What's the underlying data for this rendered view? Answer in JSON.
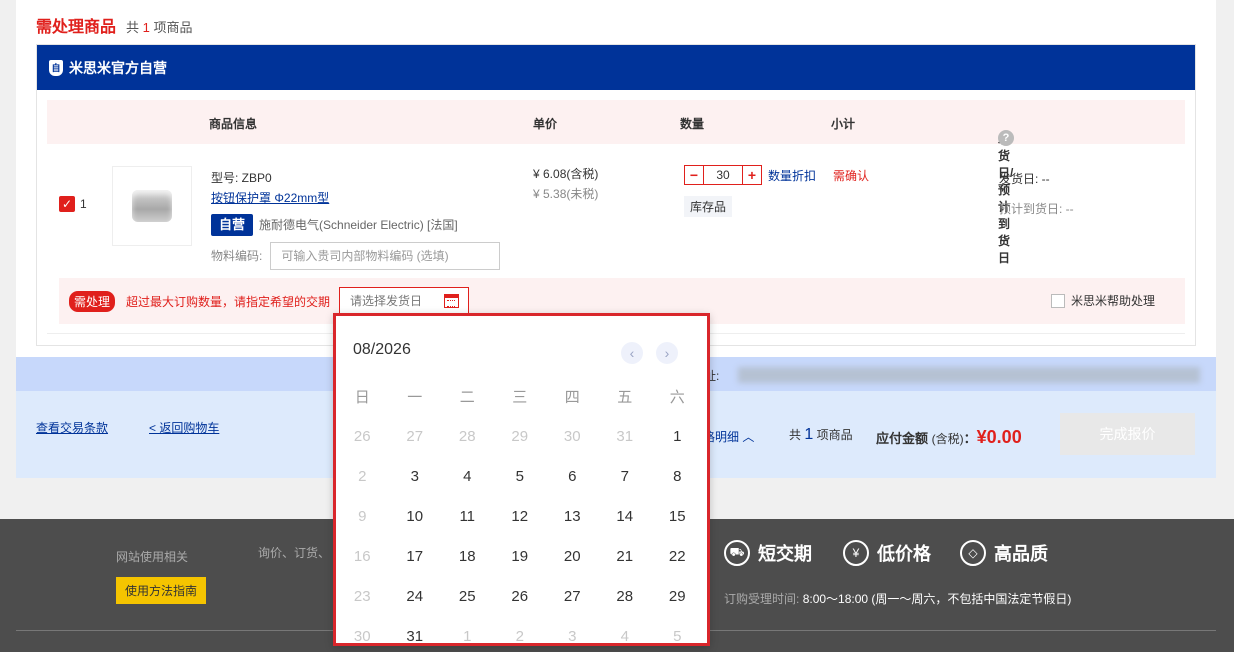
{
  "section": {
    "title": "需处理商品",
    "count_prefix": "共",
    "count": "1",
    "count_suffix": "项商品"
  },
  "shop": {
    "logo": "自",
    "name": "米思米官方自营"
  },
  "table_headers": {
    "info": "商品信息",
    "price": "单价",
    "qty": "数量",
    "subtotal": "小计",
    "ship": "发货日/预计到货日",
    "help": "?"
  },
  "item": {
    "index": "1",
    "model": "型号: ZBP0",
    "name": "按钮保护罩 Φ22mm型",
    "badge": "自营",
    "brand": "施耐德电气(Schneider Electric) [法国]",
    "material_label": "物料编码:",
    "material_placeholder": "可输入贵司内部物料编码 (选填)",
    "price_tax": "¥ 6.08(含税)",
    "price_notax": "¥ 5.38(未税)",
    "qty": "30",
    "qty_discount": "数量折扣",
    "stock": "库存品",
    "subtotal": "需确认",
    "ship_date": "发货日: --",
    "arrival_date": "预计到货日: --"
  },
  "alert": {
    "tag": "需处理",
    "message": "超过最大订购数量，请指定希望的交期",
    "date_placeholder": "请选择发货日",
    "help_label": "米思米帮助处理"
  },
  "address_label": "址:",
  "footer_bar": {
    "terms": "查看交易条款",
    "back": "< 返回购物车",
    "detail": "格明细",
    "count_prefix": "共",
    "count": "1",
    "count_suffix": "项商品",
    "total_label": "应付金额",
    "total_tax": "(含税)",
    "total_colon": "：",
    "total_value": "¥0.00",
    "submit": "完成报价"
  },
  "site_footer": {
    "usage": "网站使用相关",
    "inquiry": "询价、订货、",
    "guide": "使用方法指南",
    "features": [
      {
        "icon": "short-delivery-icon",
        "glyph": "⛟",
        "label": "短交期"
      },
      {
        "icon": "yen-icon",
        "glyph": "¥",
        "label": "低价格"
      },
      {
        "icon": "diamond-icon",
        "glyph": "◇",
        "label": "高品质"
      }
    ],
    "hours_label": "订购受理时间:",
    "hours_value": "8:00～18:00 (周一～周六，不包括中国法定节假日)"
  },
  "calendar": {
    "title": "08/2026",
    "prev": "‹",
    "next": "›",
    "weekdays": [
      "日",
      "一",
      "二",
      "三",
      "四",
      "五",
      "六"
    ],
    "weeks": [
      [
        "26",
        "27",
        "28",
        "29",
        "30",
        "31",
        "1"
      ],
      [
        "2",
        "3",
        "4",
        "5",
        "6",
        "7",
        "8"
      ],
      [
        "9",
        "10",
        "11",
        "12",
        "13",
        "14",
        "15"
      ],
      [
        "16",
        "17",
        "18",
        "19",
        "20",
        "21",
        "22"
      ],
      [
        "23",
        "24",
        "25",
        "26",
        "27",
        "28",
        "29"
      ],
      [
        "30",
        "31",
        "1",
        "2",
        "3",
        "4",
        "5"
      ]
    ]
  },
  "colors": {
    "accent_red": "#e0201c",
    "brand_blue": "#003399",
    "picker_border": "#d9262b"
  }
}
